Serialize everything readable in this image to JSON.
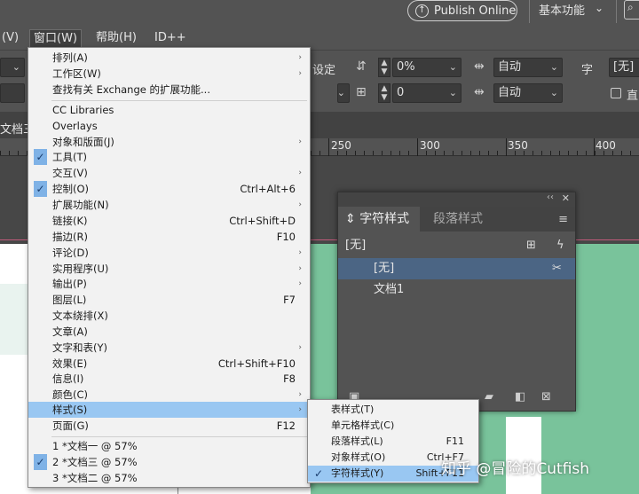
{
  "topbar": {
    "publish_label": "Publish Online",
    "publish_icon": "↑",
    "workspace_label": "基本功能",
    "workspace_chevron": "⌄",
    "search_icon": "⌕"
  },
  "menubar": {
    "items": [
      {
        "label": "(V)"
      },
      {
        "label": "窗口(W)"
      },
      {
        "label": "帮助(H)"
      },
      {
        "label": "ID++"
      }
    ]
  },
  "control": {
    "row1_label": "设定",
    "tracking_value": "0%",
    "auto1": "自动",
    "char_label": "字",
    "none_value": "[无]",
    "baseline_value": "0",
    "auto2": "自动",
    "checkbox_label": "直"
  },
  "document": {
    "tab_label": "文档三",
    "ruler_ticks": [
      "250",
      "300",
      "350",
      "400"
    ]
  },
  "window_menu": {
    "items": [
      {
        "label": "排列(A)",
        "shortcut": "",
        "submenu": true,
        "checked": false
      },
      {
        "label": "工作区(W)",
        "shortcut": "",
        "submenu": true,
        "checked": false
      },
      {
        "label": "查找有关 Exchange 的扩展功能...",
        "shortcut": "",
        "submenu": false,
        "checked": false
      },
      {
        "label": "CC Libraries",
        "shortcut": "",
        "submenu": false,
        "checked": false
      },
      {
        "label": "Overlays",
        "shortcut": "",
        "submenu": false,
        "checked": false
      },
      {
        "label": "对象和版面(J)",
        "shortcut": "",
        "submenu": true,
        "checked": false
      },
      {
        "label": "工具(T)",
        "shortcut": "",
        "submenu": false,
        "checked": true
      },
      {
        "label": "交互(V)",
        "shortcut": "",
        "submenu": true,
        "checked": false
      },
      {
        "label": "控制(O)",
        "shortcut": "Ctrl+Alt+6",
        "submenu": false,
        "checked": true
      },
      {
        "label": "扩展功能(N)",
        "shortcut": "",
        "submenu": true,
        "checked": false
      },
      {
        "label": "链接(K)",
        "shortcut": "Ctrl+Shift+D",
        "submenu": false,
        "checked": false
      },
      {
        "label": "描边(R)",
        "shortcut": "F10",
        "submenu": false,
        "checked": false
      },
      {
        "label": "评论(D)",
        "shortcut": "",
        "submenu": true,
        "checked": false
      },
      {
        "label": "实用程序(U)",
        "shortcut": "",
        "submenu": true,
        "checked": false
      },
      {
        "label": "输出(P)",
        "shortcut": "",
        "submenu": true,
        "checked": false
      },
      {
        "label": "图层(L)",
        "shortcut": "F7",
        "submenu": false,
        "checked": false
      },
      {
        "label": "文本绕排(X)",
        "shortcut": "",
        "submenu": false,
        "checked": false
      },
      {
        "label": "文章(A)",
        "shortcut": "",
        "submenu": false,
        "checked": false
      },
      {
        "label": "文字和表(Y)",
        "shortcut": "",
        "submenu": true,
        "checked": false
      },
      {
        "label": "效果(E)",
        "shortcut": "Ctrl+Shift+F10",
        "submenu": false,
        "checked": false
      },
      {
        "label": "信息(I)",
        "shortcut": "F8",
        "submenu": false,
        "checked": false
      },
      {
        "label": "颜色(C)",
        "shortcut": "",
        "submenu": true,
        "checked": false
      },
      {
        "label": "样式(S)",
        "shortcut": "",
        "submenu": true,
        "checked": false
      },
      {
        "label": "页面(G)",
        "shortcut": "F12",
        "submenu": false,
        "checked": false
      },
      {
        "label": "1 *文档一 @ 57%",
        "shortcut": "",
        "submenu": false,
        "checked": false
      },
      {
        "label": "2 *文档三 @ 57%",
        "shortcut": "",
        "submenu": false,
        "checked": true
      },
      {
        "label": "3 *文档二 @ 57%",
        "shortcut": "",
        "submenu": false,
        "checked": false
      }
    ]
  },
  "styles_submenu": {
    "items": [
      {
        "label": "表样式(T)",
        "shortcut": ""
      },
      {
        "label": "单元格样式(C)",
        "shortcut": ""
      },
      {
        "label": "段落样式(L)",
        "shortcut": "F11"
      },
      {
        "label": "对象样式(O)",
        "shortcut": "Ctrl+F7"
      },
      {
        "label": "字符样式(Y)",
        "shortcut": "Shift+F11"
      }
    ]
  },
  "char_panel": {
    "collapse_icon": "‹‹",
    "close_icon": "✕",
    "tab_active": "字符样式",
    "tab_inactive": "段落样式",
    "menu_icon": "≡",
    "current": "[无]",
    "list": [
      "[无]",
      "文档1"
    ]
  },
  "watermark": "知乎 @冒险的Cutfish",
  "colors": {
    "menu_bg": "#f2f2f2",
    "menu_highlight": "#99c7f2",
    "panel_bg": "#535353",
    "panel_selected": "#4b6584",
    "page_green": "#79c39b"
  }
}
